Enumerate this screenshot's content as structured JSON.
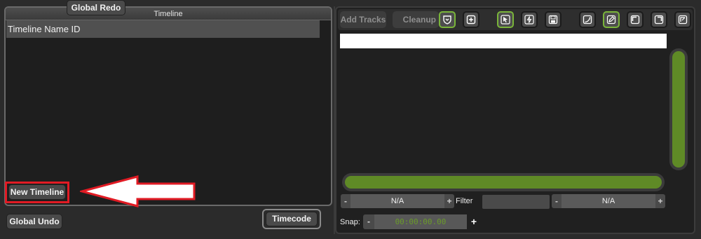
{
  "left": {
    "header_title": "Timeline",
    "list_column_header": "Timeline Name ID",
    "new_timeline_label": "New Timeline",
    "global_undo_label": "Global Undo",
    "global_redo_label": "Global Redo",
    "timecode_label": "Timecode"
  },
  "toolbar": {
    "add_tracks_label": "Add Tracks",
    "cleanup_label": "Cleanup",
    "icons": [
      {
        "name": "shield-down-icon",
        "active": true
      },
      {
        "name": "plus-box-icon",
        "active": false
      },
      {
        "name": "pointer-icon",
        "active": true
      },
      {
        "name": "bolt-icon",
        "active": false
      },
      {
        "name": "save-icon",
        "active": false
      },
      {
        "name": "curve-in-icon",
        "active": false
      },
      {
        "name": "pen-icon",
        "active": true
      },
      {
        "name": "corner-tl-icon",
        "active": false
      },
      {
        "name": "corner-tr-icon",
        "active": false
      },
      {
        "name": "corner-arrow-icon",
        "active": false
      }
    ]
  },
  "bottom": {
    "stepper_left_value": "N/A",
    "filter_label": "Filter",
    "filter_value": "",
    "stepper_right_value": "N/A",
    "snap_label": "Snap:",
    "snap_value": "00:00:00.00",
    "minus": "-",
    "plus": "+"
  },
  "colors": {
    "accent_green": "#5f8a26",
    "active_border": "#7ab53a",
    "annotation_red": "#e11b24"
  }
}
